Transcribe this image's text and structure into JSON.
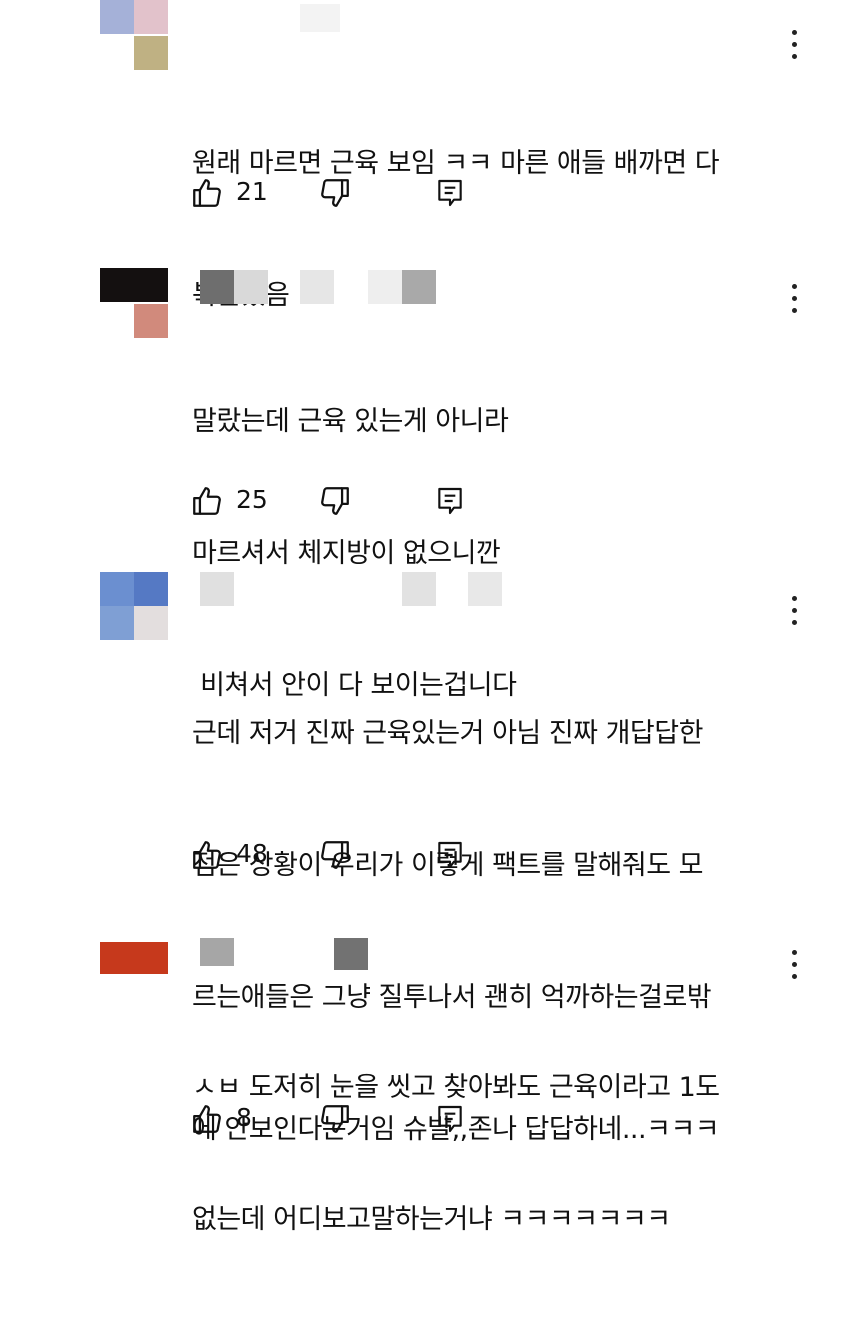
{
  "comments": [
    {
      "lines": [
        "원래 마르면 근육 보임 ㅋㅋ 마른 애들 배까면 다",
        "복근있음"
      ],
      "likes": "21"
    },
    {
      "lines": [
        "말랐는데 근육 있는게 아니라",
        "마르셔서 체지방이 없으니깐",
        " 비쳐서 안이 다 보이는겁니다"
      ],
      "likes": "25"
    },
    {
      "lines": [
        "근데 저거 진짜 근육있는거 아님 진짜 개답답한",
        "점은 상황이 우리가 이렇게 팩트를 말해줘도 모",
        "르는애들은 그냥 질투나서 괜히 억까하는걸로밖",
        "에 안보인다는거임 슈발,,존나 답답하네...ㅋㅋㅋ"
      ],
      "likes": "48"
    },
    {
      "lines": [
        "ㅅㅂ 도저히 눈을 씻고 찾아봐도 근육이라고 1도",
        "없는데 어디보고말하는거냐 ㅋㅋㅋㅋㅋㅋㅋ"
      ],
      "likes": "8"
    }
  ],
  "icons": {
    "like": "thumbs-up-icon",
    "dislike": "thumbs-down-icon",
    "reply": "reply-icon",
    "menu": "more-vertical-icon"
  }
}
